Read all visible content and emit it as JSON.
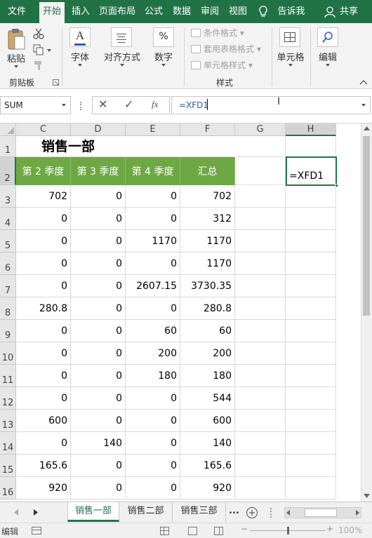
{
  "ribbon_tabs": [
    "文件",
    "开始",
    "插入",
    "页面布局",
    "公式",
    "数据",
    "审阅",
    "视图"
  ],
  "tell_me": "告诉我",
  "share": "共享",
  "ribbon": {
    "paste": "粘贴",
    "clipboard": "剪贴板",
    "font": "字体",
    "align": "对齐方式",
    "number": "数字",
    "cond_format": "条件格式",
    "table_format": "套用表格格式",
    "cell_style": "单元格样式",
    "styles": "样式",
    "cells": "单元格",
    "edit": "编辑",
    "font_glyph": "A",
    "number_glyph": "%"
  },
  "formula_bar": {
    "name_box": "SUM",
    "cancel": "✕",
    "enter": "✓",
    "fx": "fx",
    "formula": "=XFD1"
  },
  "columns": [
    "C",
    "D",
    "E",
    "F",
    "G",
    "H"
  ],
  "rows": [
    "1",
    "2",
    "3",
    "4",
    "5",
    "6",
    "7",
    "8",
    "9",
    "10",
    "11",
    "12",
    "13",
    "14",
    "15",
    "16"
  ],
  "sheet_title": "销售一部",
  "table_headers": [
    "第 2 季度",
    "第 3 季度",
    "第 4 季度",
    "汇总"
  ],
  "table_rows": [
    [
      "702",
      "0",
      "0",
      "702"
    ],
    [
      "0",
      "0",
      "0",
      "312"
    ],
    [
      "0",
      "0",
      "1170",
      "1170"
    ],
    [
      "0",
      "0",
      "0",
      "1170"
    ],
    [
      "0",
      "0",
      "2607.15",
      "3730.35"
    ],
    [
      "280.8",
      "0",
      "0",
      "280.8"
    ],
    [
      "0",
      "0",
      "60",
      "60"
    ],
    [
      "0",
      "0",
      "200",
      "200"
    ],
    [
      "0",
      "0",
      "180",
      "180"
    ],
    [
      "0",
      "0",
      "0",
      "544"
    ],
    [
      "600",
      "0",
      "0",
      "600"
    ],
    [
      "0",
      "140",
      "0",
      "140"
    ],
    [
      "165.6",
      "0",
      "0",
      "165.6"
    ],
    [
      "920",
      "0",
      "0",
      "920"
    ]
  ],
  "active_cell_value": "=XFD1",
  "sheet_tabs": [
    "销售一部",
    "销售二部",
    "销售三部"
  ],
  "sheet_more": "...",
  "status": {
    "mode": "编辑",
    "zoom": "100%"
  },
  "colors": {
    "accent": "#217346",
    "header_fill": "#6ea844"
  }
}
